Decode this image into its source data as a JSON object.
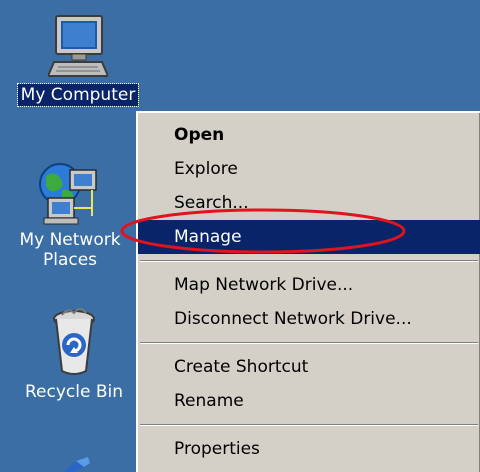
{
  "desktop": {
    "icons": [
      {
        "name": "My Computer",
        "lines": [
          "My Computer"
        ],
        "selected": true,
        "icon": "computer-icon"
      },
      {
        "name": "My Network Places",
        "lines": [
          "My Network",
          "Places"
        ],
        "selected": false,
        "icon": "network-places-icon"
      },
      {
        "name": "Recycle Bin",
        "lines": [
          "Recycle Bin"
        ],
        "selected": false,
        "icon": "recycle-bin-icon"
      }
    ],
    "background_color": "#3A6EA5"
  },
  "context_menu": {
    "groups": [
      [
        "Open",
        "Explore",
        "Search...",
        "Manage"
      ],
      [
        "Map Network Drive...",
        "Disconnect Network Drive..."
      ],
      [
        "Create Shortcut",
        "Rename"
      ],
      [
        "Properties"
      ]
    ],
    "default_item": "Open",
    "highlighted_item": "Manage",
    "highlight_color": "#0A246A",
    "menu_background": "#D4D0C8"
  },
  "annotation": {
    "shape": "ellipse",
    "color": "#E0141E",
    "target": "Manage"
  }
}
